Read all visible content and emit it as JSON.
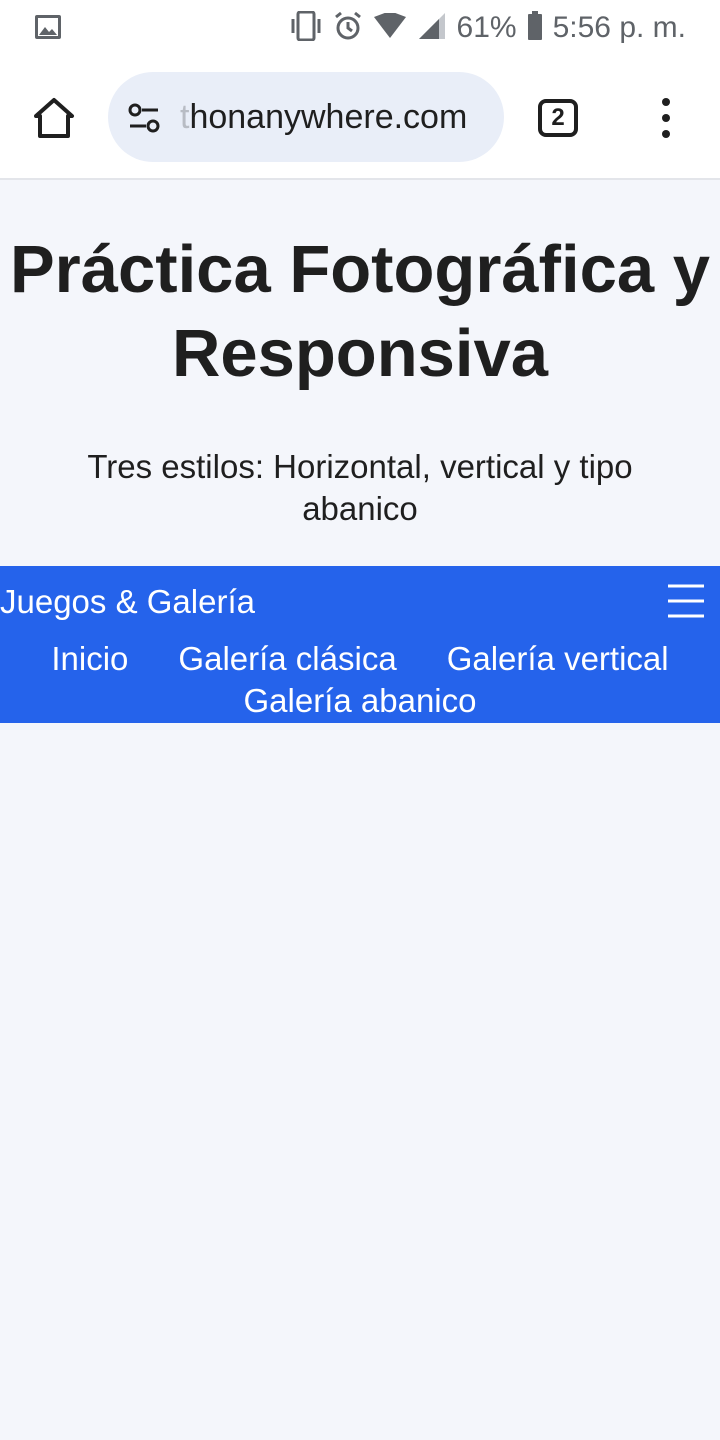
{
  "status_bar": {
    "battery": "61%",
    "time": "5:56 p. m.",
    "icons": [
      "image-icon",
      "vibrate-icon",
      "alarm-icon",
      "wifi-icon",
      "signal-icon",
      "battery-icon"
    ]
  },
  "browser": {
    "url_faded": "t",
    "url": "honanywhere.com",
    "tab_count": "2",
    "icons": [
      "home-icon",
      "tune-icon",
      "more-vert-icon"
    ]
  },
  "page": {
    "title": "Práctica Fotográfica y Responsiva",
    "subtitle": "Tres estilos: Horizontal, vertical y tipo abanico"
  },
  "nav": {
    "brand": "Juegos & Galería",
    "links": [
      {
        "label": "Inicio"
      },
      {
        "label": "Galería clásica"
      },
      {
        "label": "Galería vertical"
      },
      {
        "label": "Galería abanico"
      }
    ],
    "color": "#2563eb"
  }
}
